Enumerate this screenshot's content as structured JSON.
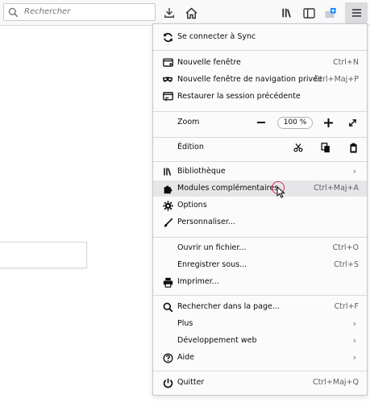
{
  "toolbar": {
    "search_placeholder": "Rechercher",
    "icons": [
      "download-icon",
      "home-icon",
      "library-icon",
      "sidebar-icon",
      "screenshot-icon",
      "hamburger-menu-icon"
    ]
  },
  "menu": {
    "sync": "Se connecter à Sync",
    "new_window": {
      "label": "Nouvelle fenêtre",
      "shortcut": "Ctrl+N"
    },
    "new_private": {
      "label": "Nouvelle fenêtre de navigation privée",
      "shortcut": "Ctrl+Maj+P"
    },
    "restore_session": "Restaurer la session précédente",
    "zoom": {
      "label": "Zoom",
      "value": "100 %",
      "minus": "—",
      "plus": "+"
    },
    "edit": {
      "label": "Édition"
    },
    "library": "Bibliothèque",
    "addons": {
      "label": "Modules complémentaires",
      "shortcut": "Ctrl+Maj+A"
    },
    "options": "Options",
    "customize": "Personnaliser...",
    "open_file": {
      "label": "Ouvrir un fichier...",
      "shortcut": "Ctrl+O"
    },
    "save_as": {
      "label": "Enregistrer sous...",
      "shortcut": "Ctrl+S"
    },
    "print": "Imprimer...",
    "find": {
      "label": "Rechercher dans la page...",
      "shortcut": "Ctrl+F"
    },
    "more": "Plus",
    "webdev": "Développement web",
    "help": "Aide",
    "quit": {
      "label": "Quitter",
      "shortcut": "Ctrl+Maj+Q"
    }
  },
  "colors": {
    "highlight": "#e6e6e8",
    "cursor_ring": "#e22850",
    "accent_blue": "#0a84ff"
  }
}
